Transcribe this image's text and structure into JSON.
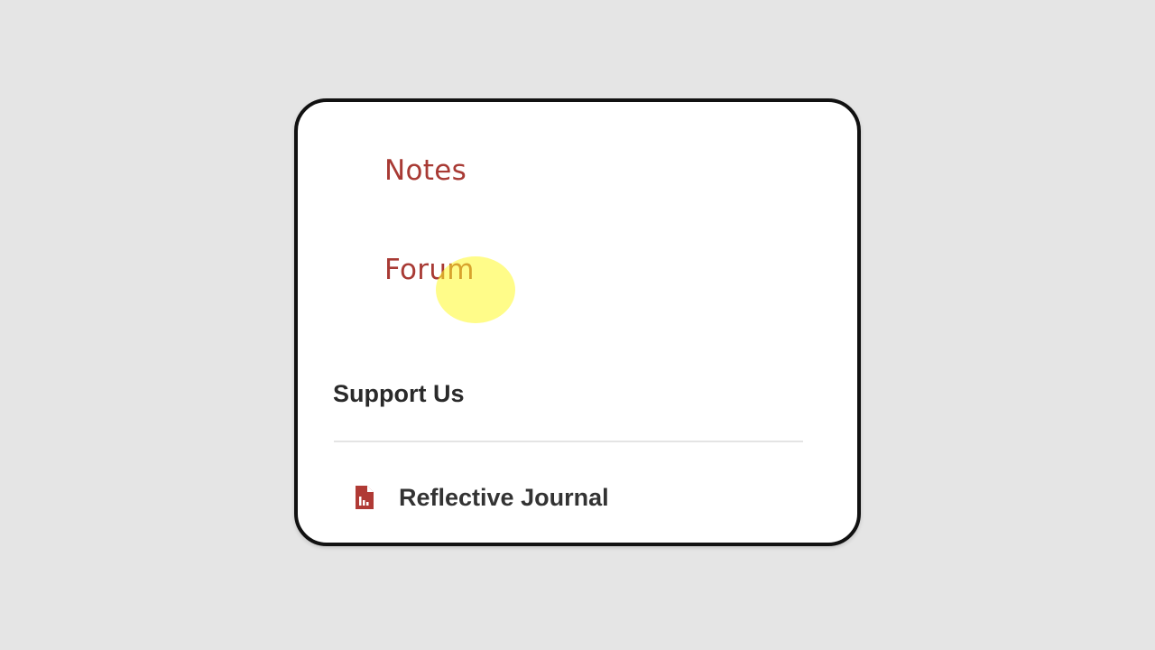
{
  "menu": {
    "links": [
      {
        "label": "Notes"
      },
      {
        "label": "Forum"
      }
    ],
    "support_section": {
      "title": "Support Us",
      "items": [
        {
          "label": "Reflective Journal",
          "icon": "pdf-file-icon"
        }
      ]
    }
  },
  "colors": {
    "background": "#e5e5e5",
    "card": "#ffffff",
    "link": "#a83a34",
    "heading": "#2a2a2a",
    "icon": "#b03a35",
    "cursor_highlight": "#fffa28"
  }
}
